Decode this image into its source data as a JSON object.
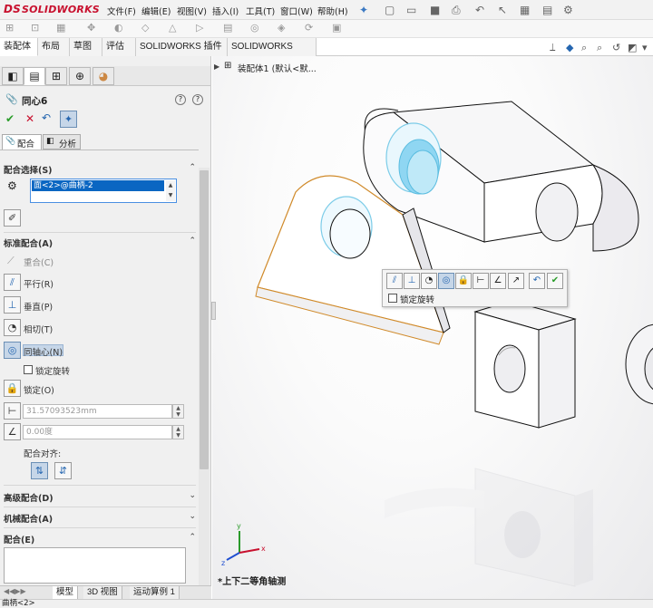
{
  "app": {
    "logo": "SOLIDWORKS",
    "logo_mark": "DS"
  },
  "menu": [
    "文件(F)",
    "编辑(E)",
    "视图(V)",
    "插入(I)",
    "工具(T)",
    "窗口(W)",
    "帮助(H)"
  ],
  "tabs": [
    "装配体",
    "布局",
    "草图",
    "评估",
    "SOLIDWORKS 插件",
    "SOLIDWORKS MBD"
  ],
  "tree": {
    "label": "装配体1 (默认<默..."
  },
  "panel": {
    "title": "同心6",
    "subtabs": [
      "配合",
      "分析"
    ],
    "mate_selection": {
      "header": "配合选择(S)",
      "item": "面<2>@曲柄-2"
    },
    "standard": {
      "header": "标准配合(A)",
      "coincident": "重合(C)",
      "parallel": "平行(R)",
      "perpendicular": "垂直(P)",
      "tangent": "相切(T)",
      "concentric": "同轴心(N)",
      "lock_rotation": "锁定旋转",
      "lock": "锁定(O)",
      "distance": "31.57093523mm",
      "angle": "0.00度",
      "alignment": "配合对齐:"
    },
    "advanced": "高级配合(D)",
    "mechanical": "机械配合(A)",
    "mates": "配合(E)"
  },
  "popup": {
    "lock_rotation": "锁定旋转"
  },
  "viewport": {
    "view_label": "*上下二等角轴测"
  },
  "bottom_tabs": [
    "模型",
    "3D 视图",
    "运动算例 1"
  ],
  "status": "曲柄<2>",
  "colors": {
    "brand": "#c8102e",
    "selection": "#0a66c2",
    "highlight_edge": "#d08a2a",
    "cylinder_face": "#8fd6f2"
  }
}
